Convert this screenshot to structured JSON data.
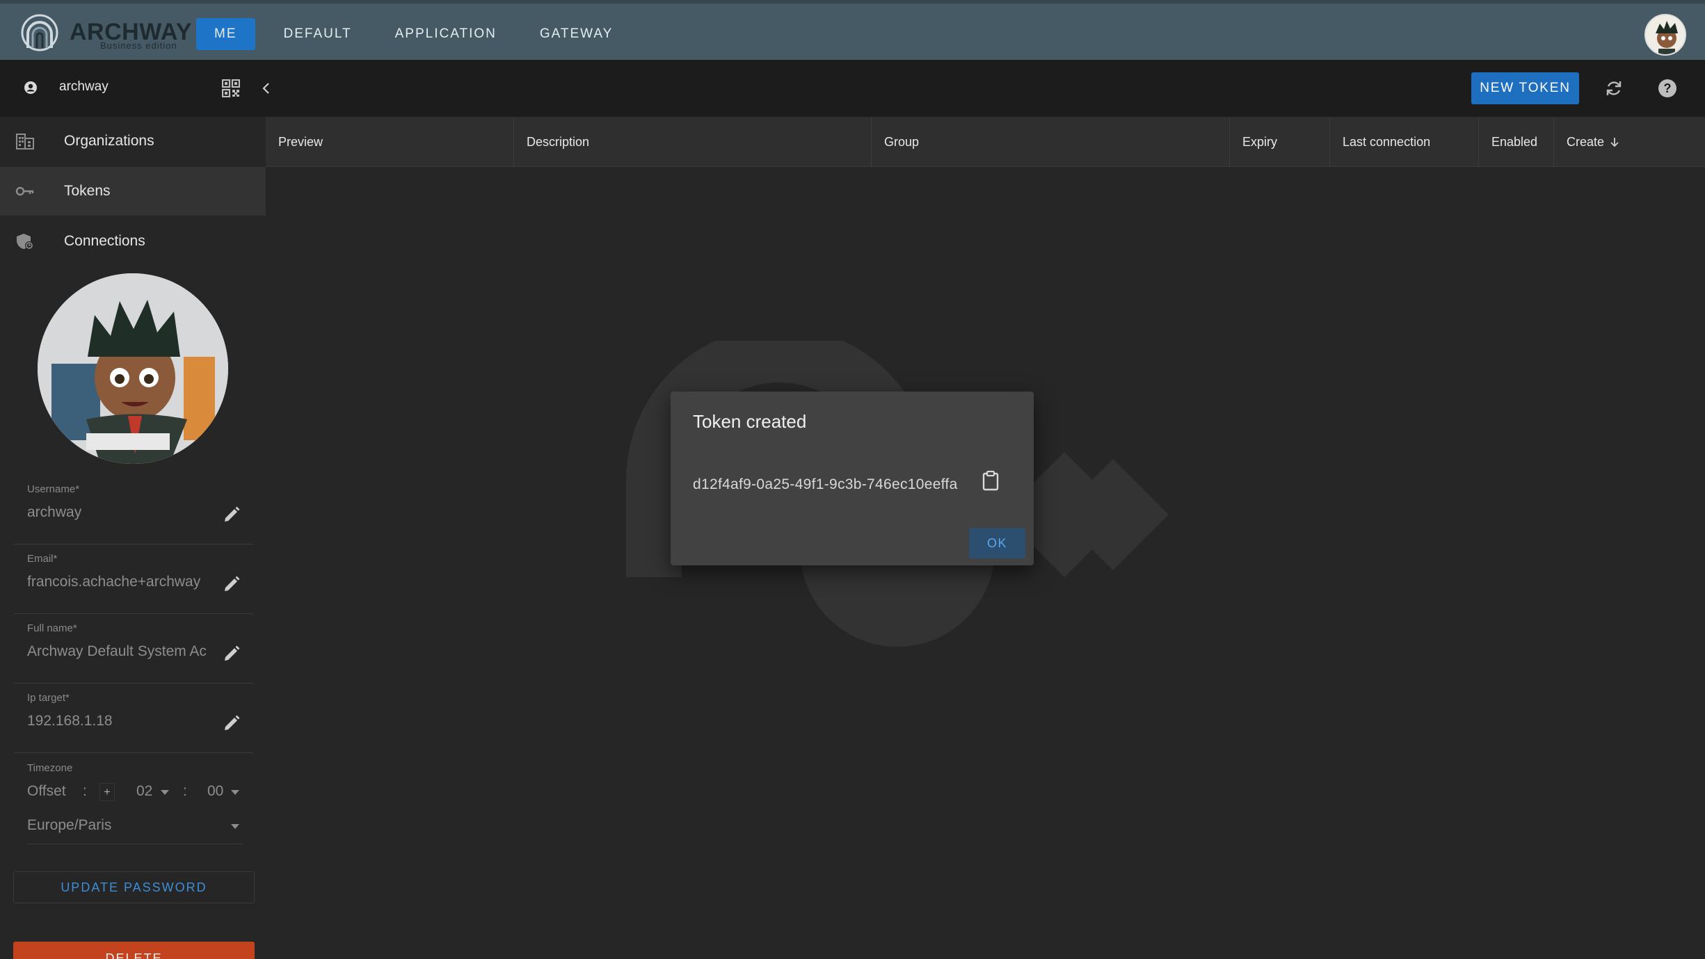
{
  "app": {
    "brand": "ARCHWAY",
    "edition": "Business edition"
  },
  "nav": {
    "items": [
      {
        "label": "ME",
        "active": true
      },
      {
        "label": "DEFAULT",
        "active": false
      },
      {
        "label": "APPLICATION",
        "active": false
      },
      {
        "label": "GATEWAY",
        "active": false
      }
    ]
  },
  "toolbar": {
    "username": "archway",
    "new_token_label": "NEW TOKEN",
    "icons": [
      "account-icon",
      "qr-code-icon",
      "chevron-left-icon",
      "refresh-icon",
      "help-icon"
    ]
  },
  "sidebar": {
    "items": [
      {
        "label": "Organizations",
        "icon": "organizations-icon",
        "active": false
      },
      {
        "label": "Tokens",
        "icon": "key-icon",
        "active": true
      },
      {
        "label": "Connections",
        "icon": "shield-connection-icon",
        "active": false
      }
    ]
  },
  "profile": {
    "fields": [
      {
        "label": "Username*",
        "value": "archway"
      },
      {
        "label": "Email*",
        "value": "francois.achache+archway"
      },
      {
        "label": "Full name*",
        "value": "Archway Default System Ac"
      },
      {
        "label": "Ip target*",
        "value": "192.168.1.18"
      }
    ],
    "timezone": {
      "label": "Timezone",
      "offset_label": "Offset",
      "sep1": ":",
      "sign": "+",
      "hours": "02",
      "sep2": ":",
      "minutes": "00",
      "zone": "Europe/Paris"
    },
    "update_password_label": "UPDATE PASSWORD",
    "delete_label": "DELETE"
  },
  "table": {
    "columns": [
      "Preview",
      "Description",
      "Group",
      "Expiry",
      "Last connection",
      "Enabled",
      "Create"
    ],
    "sort_column": "Create",
    "sort_direction": "descending"
  },
  "dialog": {
    "title": "Token created",
    "token": "d12f4af9-0a25-49f1-9c3b-746ec10eeffa",
    "ok_label": "OK"
  },
  "colors": {
    "appbar": "#455a64",
    "primary": "#1e74c6",
    "danger": "#c4431f",
    "background": "#262626",
    "dialog": "#424242"
  }
}
